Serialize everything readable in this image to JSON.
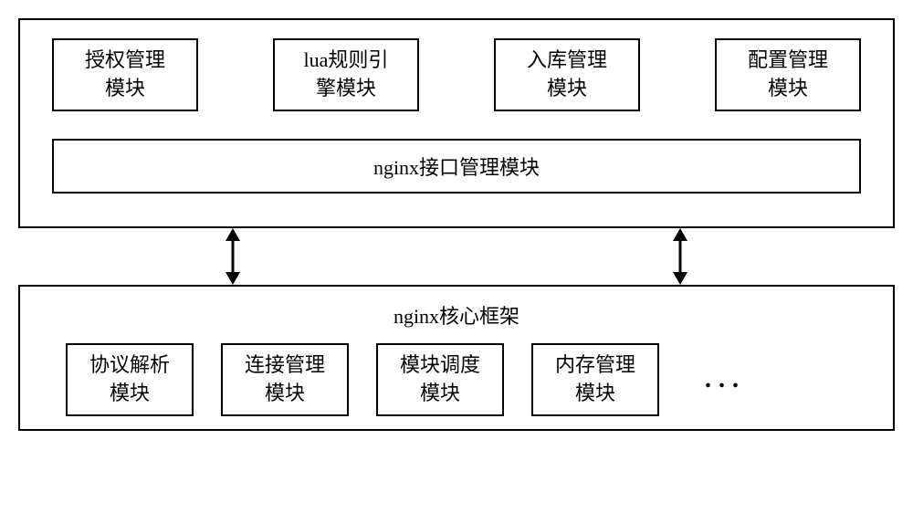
{
  "top_modules": {
    "auth": "授权管理\n模块",
    "lua": "lua规则引\n擎模块",
    "store": "入库管理\n模块",
    "config": "配置管理\n模块"
  },
  "interface_module": "nginx接口管理模块",
  "bottom_title": "nginx核心框架",
  "bottom_modules": {
    "protocol": "协议解析\n模块",
    "connection": "连接管理\n模块",
    "schedule": "模块调度\n模块",
    "memory": "内存管理\n模块"
  },
  "ellipsis": "..."
}
